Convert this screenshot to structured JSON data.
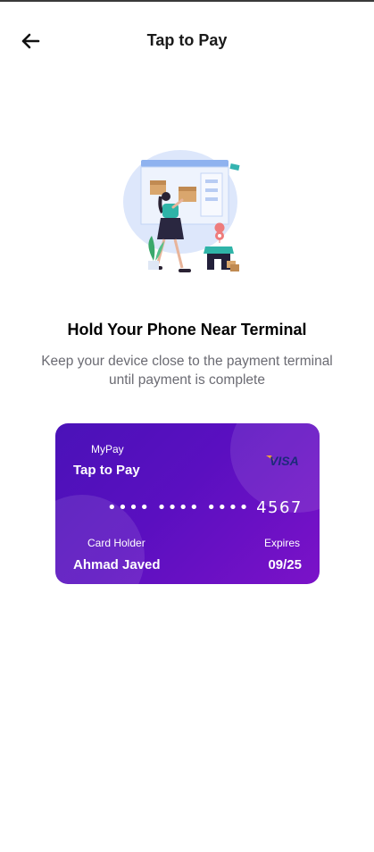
{
  "header": {
    "title": "Tap to Pay",
    "back_icon": "arrow-left-icon"
  },
  "illustration": {
    "icon": "delivery-illustration"
  },
  "main": {
    "heading": "Hold Your Phone Near Terminal",
    "subtext": "Keep your device close to the payment terminal until payment is complete"
  },
  "card": {
    "brand": "MyPay",
    "title": "Tap to Pay",
    "network_logo": "visa-logo",
    "network_text": "VISA",
    "number": "•••• •••• •••• 4567",
    "holder_label": "Card Holder",
    "holder_name": "Ahmad Javed",
    "expires_label": "Expires",
    "expires_value": "09/25",
    "gradient": [
      "#4a12b8",
      "#7b12c8"
    ]
  },
  "colors": {
    "accent": "#5a0fc0",
    "subtext": "#6b6b73"
  }
}
